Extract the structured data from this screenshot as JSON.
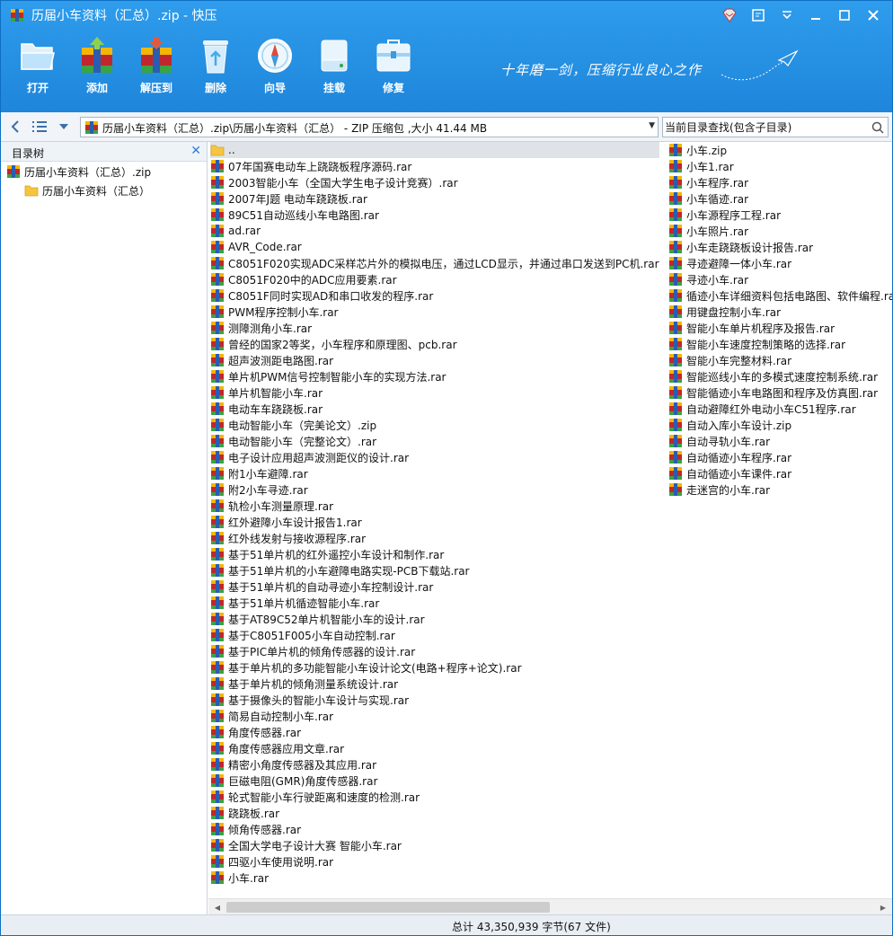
{
  "window": {
    "title": "历届小车资料（汇总）.zip - 快压"
  },
  "toolbar": {
    "items": [
      {
        "label": "打开",
        "icon": "folder-open-icon"
      },
      {
        "label": "添加",
        "icon": "add-archive-icon"
      },
      {
        "label": "解压到",
        "icon": "extract-icon"
      },
      {
        "label": "删除",
        "icon": "recycle-bin-icon"
      },
      {
        "label": "向导",
        "icon": "compass-icon"
      },
      {
        "label": "挂载",
        "icon": "mount-drive-icon"
      },
      {
        "label": "修复",
        "icon": "toolbox-icon"
      }
    ],
    "slogan": "十年磨一剑，压缩行业良心之作"
  },
  "address": {
    "path": "历届小车资料（汇总）.zip\\历届小车资料（汇总） - ZIP 压缩包 ,大小 41.44 MB",
    "search_placeholder": "当前目录查找(包含子目录)"
  },
  "tree": {
    "title": "目录树",
    "root": "历届小车资料（汇总）.zip",
    "child": "历届小车资料（汇总）"
  },
  "files_col1": [
    {
      "name": "..",
      "type": "folder"
    },
    {
      "name": "07年国赛电动车上跷跷板程序源码.rar",
      "type": "rar"
    },
    {
      "name": "2003智能小车（全国大学生电子设计竞赛）.rar",
      "type": "rar"
    },
    {
      "name": "2007年J题 电动车跷跷板.rar",
      "type": "rar"
    },
    {
      "name": "89C51自动巡线小车电路图.rar",
      "type": "rar"
    },
    {
      "name": "ad.rar",
      "type": "rar"
    },
    {
      "name": "AVR_Code.rar",
      "type": "rar"
    },
    {
      "name": "C8051F020实现ADC采样芯片外的模拟电压，通过LCD显示，并通过串口发送到PC机.rar",
      "type": "rar"
    },
    {
      "name": "C8051F020中的ADC应用要素.rar",
      "type": "rar"
    },
    {
      "name": "C8051F同时实现AD和串口收发的程序.rar",
      "type": "rar"
    },
    {
      "name": "PWM程序控制小车.rar",
      "type": "rar"
    },
    {
      "name": "测障测角小车.rar",
      "type": "rar"
    },
    {
      "name": "曾经的国家2等奖，小车程序和原理图、pcb.rar",
      "type": "rar"
    },
    {
      "name": "超声波测距电路图.rar",
      "type": "rar"
    },
    {
      "name": "单片机PWM信号控制智能小车的实现方法.rar",
      "type": "rar"
    },
    {
      "name": "单片机智能小车.rar",
      "type": "rar"
    },
    {
      "name": "电动车车跷跷板.rar",
      "type": "rar"
    },
    {
      "name": "电动智能小车（完美论文）.zip",
      "type": "rar"
    },
    {
      "name": "电动智能小车（完整论文）.rar",
      "type": "rar"
    },
    {
      "name": "电子设计应用超声波测距仪的设计.rar",
      "type": "rar"
    },
    {
      "name": "附1小车避障.rar",
      "type": "rar"
    },
    {
      "name": "附2小车寻迹.rar",
      "type": "rar"
    },
    {
      "name": "轨检小车测量原理.rar",
      "type": "rar"
    },
    {
      "name": "红外避障小车设计报告1.rar",
      "type": "rar"
    },
    {
      "name": "红外线发射与接收源程序.rar",
      "type": "rar"
    },
    {
      "name": "基于51单片机的红外遥控小车设计和制作.rar",
      "type": "rar"
    },
    {
      "name": "基于51单片机的小车避障电路实现-PCB下载站.rar",
      "type": "rar"
    },
    {
      "name": "基于51单片机的自动寻迹小车控制设计.rar",
      "type": "rar"
    },
    {
      "name": "基于51单片机循迹智能小车.rar",
      "type": "rar"
    },
    {
      "name": "基于AT89C52单片机智能小车的设计.rar",
      "type": "rar"
    },
    {
      "name": "基于C8051F005小车自动控制.rar",
      "type": "rar"
    },
    {
      "name": "基于PIC单片机的倾角传感器的设计.rar",
      "type": "rar"
    },
    {
      "name": "基于单片机的多功能智能小车设计论文(电路+程序+论文).rar",
      "type": "rar"
    },
    {
      "name": "基于单片机的倾角测量系统设计.rar",
      "type": "rar"
    },
    {
      "name": "基于摄像头的智能小车设计与实现.rar",
      "type": "rar"
    },
    {
      "name": "简易自动控制小车.rar",
      "type": "rar"
    },
    {
      "name": "角度传感器.rar",
      "type": "rar"
    },
    {
      "name": "角度传感器应用文章.rar",
      "type": "rar"
    },
    {
      "name": "精密小角度传感器及其应用.rar",
      "type": "rar"
    },
    {
      "name": "巨磁电阻(GMR)角度传感器.rar",
      "type": "rar"
    },
    {
      "name": "轮式智能小车行驶距离和速度的检测.rar",
      "type": "rar"
    },
    {
      "name": "跷跷板.rar",
      "type": "rar"
    },
    {
      "name": "倾角传感器.rar",
      "type": "rar"
    },
    {
      "name": "全国大学电子设计大赛 智能小车.rar",
      "type": "rar"
    },
    {
      "name": "四驱小车使用说明.rar",
      "type": "rar"
    },
    {
      "name": "小车.rar",
      "type": "rar"
    }
  ],
  "files_col2": [
    {
      "name": "小车.zip",
      "type": "rar"
    },
    {
      "name": "小车1.rar",
      "type": "rar"
    },
    {
      "name": "小车程序.rar",
      "type": "rar"
    },
    {
      "name": "小车循迹.rar",
      "type": "rar"
    },
    {
      "name": "小车源程序工程.rar",
      "type": "rar"
    },
    {
      "name": "小车照片.rar",
      "type": "rar"
    },
    {
      "name": "小车走跷跷板设计报告.rar",
      "type": "rar"
    },
    {
      "name": "寻迹避障一体小车.rar",
      "type": "rar"
    },
    {
      "name": "寻迹小车.rar",
      "type": "rar"
    },
    {
      "name": "循迹小车详细资料包括电路图、软件编程.rar",
      "type": "rar"
    },
    {
      "name": "用键盘控制小车.rar",
      "type": "rar"
    },
    {
      "name": "智能小车单片机程序及报告.rar",
      "type": "rar"
    },
    {
      "name": "智能小车速度控制策略的选择.rar",
      "type": "rar"
    },
    {
      "name": "智能小车完整材料.rar",
      "type": "rar"
    },
    {
      "name": "智能巡线小车的多模式速度控制系统.rar",
      "type": "rar"
    },
    {
      "name": "智能循迹小车电路图和程序及仿真图.rar",
      "type": "rar"
    },
    {
      "name": "自动避障红外电动小车C51程序.rar",
      "type": "rar"
    },
    {
      "name": "自动入库小车设计.zip",
      "type": "rar"
    },
    {
      "name": "自动寻轨小车.rar",
      "type": "rar"
    },
    {
      "name": "自动循迹小车程序.rar",
      "type": "rar"
    },
    {
      "name": "自动循迹小车课件.rar",
      "type": "rar"
    },
    {
      "name": "走迷宫的小车.rar",
      "type": "rar"
    }
  ],
  "status": {
    "text": "总计  43,350,939 字节(67 文件)"
  },
  "colors": {
    "header_blue": "#1e86db",
    "accent": "#2e7fd0"
  }
}
